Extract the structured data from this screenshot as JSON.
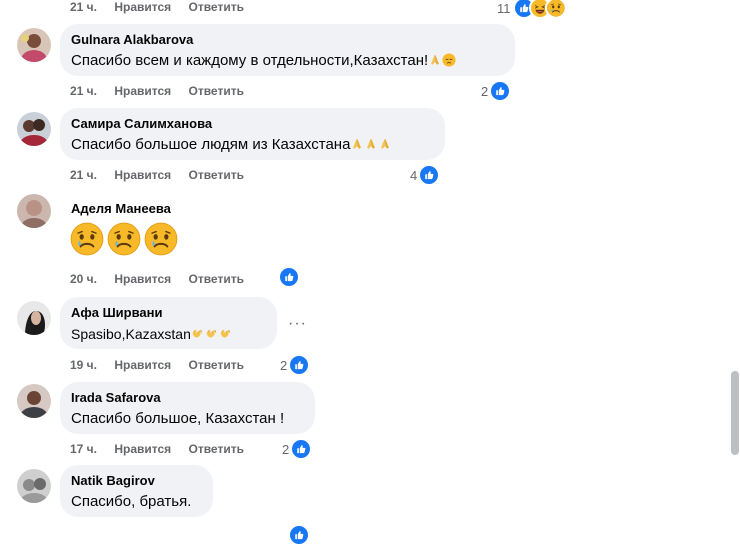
{
  "top_row": {
    "time": "21 ч.",
    "like": "Нравится",
    "reply": "Ответить",
    "count": "11"
  },
  "comments": [
    {
      "author": "Gulnara Alakbarova",
      "text": "Спасибо всем и каждому в отдельности,Казахстан!",
      "time": "21 ч.",
      "like": "Нравится",
      "reply": "Ответить",
      "count": "2"
    },
    {
      "author": "Самира Салимханова",
      "text": "Спасибо большое людям из Казахстана",
      "time": "21 ч.",
      "like": "Нравится",
      "reply": "Ответить",
      "count": "4"
    },
    {
      "author": "Аделя Манеева",
      "text": "",
      "time": "20 ч.",
      "like": "Нравится",
      "reply": "Ответить",
      "count": ""
    },
    {
      "author": "Афа Ширвани",
      "text": "Spasibo,Kazaxstan",
      "time": "19 ч.",
      "like": "Нравится",
      "reply": "Ответить",
      "count": "2"
    },
    {
      "author": "Irada Safarova",
      "text": "Спасибо большое, Казахстан !",
      "time": "17 ч.",
      "like": "Нравится",
      "reply": "Ответить",
      "count": "2"
    },
    {
      "author": "Natik Bagirov",
      "text": "Спасибо, братья.",
      "time": "",
      "like": "",
      "reply": "",
      "count": ""
    }
  ],
  "more_options": "···",
  "colors": {
    "accent": "#1877f2",
    "bubble": "#f0f2f5",
    "meta": "#65676b"
  },
  "icons": [
    "like-icon",
    "haha-icon",
    "sad-icon",
    "care-icon",
    "pray-emoji",
    "crying-emoji",
    "hands-emoji",
    "more-options-icon"
  ]
}
